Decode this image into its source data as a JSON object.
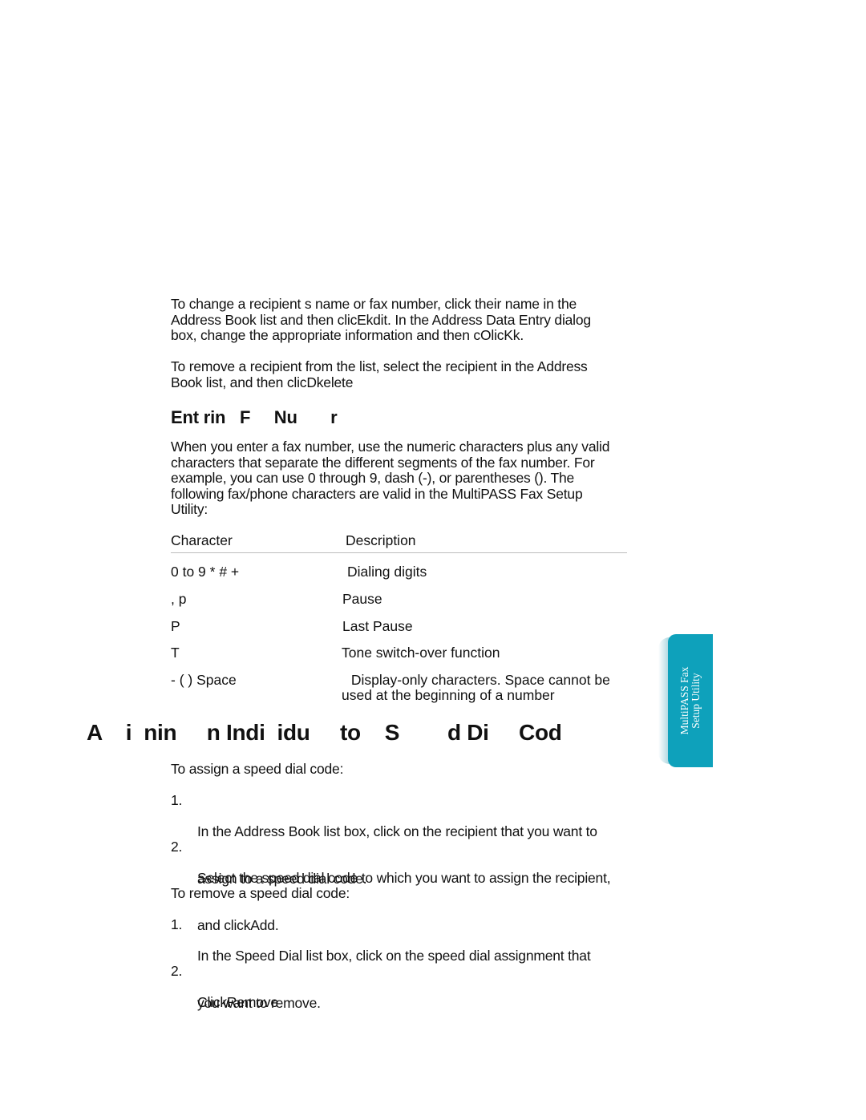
{
  "intro": {
    "para1_lines": [
      "To change a recipient s name or fax number, click their name in the",
      "Address Book list and then clicEkdit. In the Address Data Entry dialog",
      "box, change the appropriate information and then cOlicKk."
    ],
    "para2_lines": [
      "To remove a recipient from the list, select the recipient in the Address",
      "Book list, and then clicDkelete"
    ]
  },
  "section_entering": {
    "heading": "Ent rin   F     Nu       r",
    "body_lines": [
      "When you enter a fax number, use the numeric characters plus any valid",
      "characters that separate the different segments of the fax number. For",
      "example, you can use 0 through 9, dash (-), or parentheses (). The",
      "following fax/phone characters are valid in the MultiPASS Fax Setup",
      "Utility:"
    ],
    "table": {
      "headers": [
        "Character",
        "Description"
      ],
      "rows": [
        {
          "character": "0 to 9 * # +",
          "description": "Dialing digits"
        },
        {
          "character": ", p",
          "description": "Pause"
        },
        {
          "character": "P",
          "description": "Last Pause"
        },
        {
          "character": "T",
          "description": "Tone switch-over function"
        },
        {
          "character": "- ( ) Space",
          "description": " Display-only characters. Space cannot be",
          "description_line2": "used at the beginning of a number"
        }
      ]
    }
  },
  "section_assign": {
    "heading": "A    i  nin     n Indi  idu     to    S        d Di     Cod",
    "assign_intro": "To assign a speed dial code:",
    "assign_steps": [
      {
        "num": "1.",
        "lines": [
          "In the Address Book list box, click on the recipient that you want to",
          "assign to a speed dial code."
        ]
      },
      {
        "num": "2.",
        "lines": [
          "Select the speed dial code to which you want to assign the recipient,",
          "and clickAdd."
        ]
      }
    ],
    "remove_intro": "To remove a speed dial code:",
    "remove_steps": [
      {
        "num": "1.",
        "lines": [
          "In the Speed Dial list box, click on the speed dial assignment that",
          "you want to remove."
        ]
      },
      {
        "num": "2.",
        "lines": [
          "ClickRemove"
        ]
      }
    ]
  },
  "side_tab": {
    "line1": "MultiPASS Fax",
    "line2": "Setup Utility",
    "color": "#0ea1bb"
  }
}
